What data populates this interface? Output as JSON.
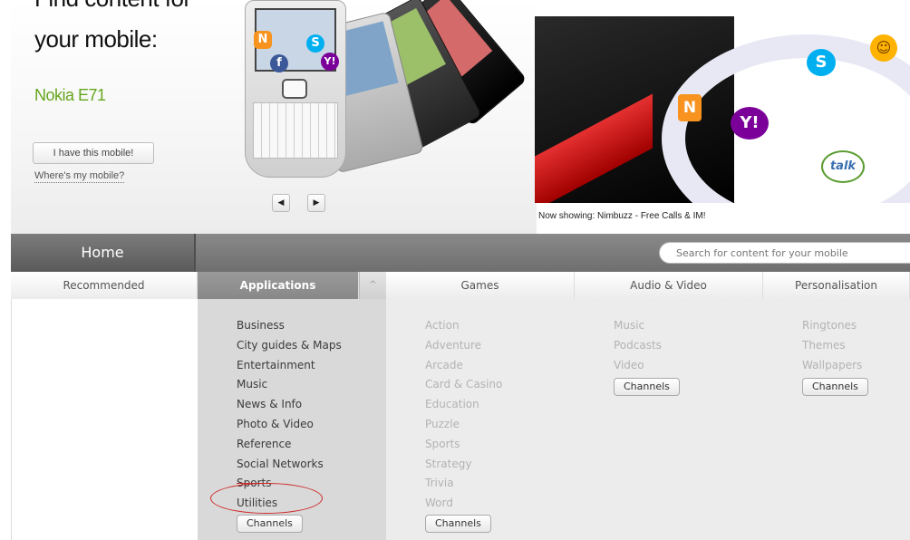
{
  "hero": {
    "title_line1": "Find content for",
    "title_line2": "your mobile:",
    "device_name": "Nokia E71",
    "have_button": "I have this mobile!",
    "where_link": "Where's my mobile?",
    "prev_arrow": "◀",
    "next_arrow": "▶",
    "showcase_caption": "Now showing: Nimbuzz -  Free Calls & IM!"
  },
  "nav": {
    "home": "Home",
    "search_placeholder": "Search for content for your mobile"
  },
  "categories": {
    "recommended": "Recommended",
    "applications": "Applications",
    "games": "Games",
    "audio_video": "Audio & Video",
    "personalisation": "Personalisation",
    "caret": "^"
  },
  "applications": {
    "items": [
      "Business",
      "City guides & Maps",
      "Entertainment",
      "Music",
      "News & Info",
      "Photo & Video",
      "Reference",
      "Social Networks",
      "Sports",
      "Utilities"
    ],
    "channels": "Channels"
  },
  "games": {
    "items": [
      "Action",
      "Adventure",
      "Arcade",
      "Card & Casino",
      "Education",
      "Puzzle",
      "Sports",
      "Strategy",
      "Trivia",
      "Word"
    ],
    "channels": "Channels"
  },
  "audio_video": {
    "items": [
      "Music",
      "Podcasts",
      "Video"
    ],
    "channels": "Channels"
  },
  "personalisation": {
    "items": [
      "Ringtones",
      "Themes",
      "Wallpapers"
    ],
    "channels": "Channels"
  },
  "colors": {
    "accent_green": "#66a61e",
    "annotation_red": "#cf2a2a",
    "nav_gray": "#6e6e6e"
  },
  "icons": [
    "nimbuzz-icon",
    "facebook-icon",
    "skype-icon",
    "yahoo-icon",
    "talk-icon",
    "smiley-icon",
    "chevron-left-icon",
    "chevron-right-icon"
  ]
}
